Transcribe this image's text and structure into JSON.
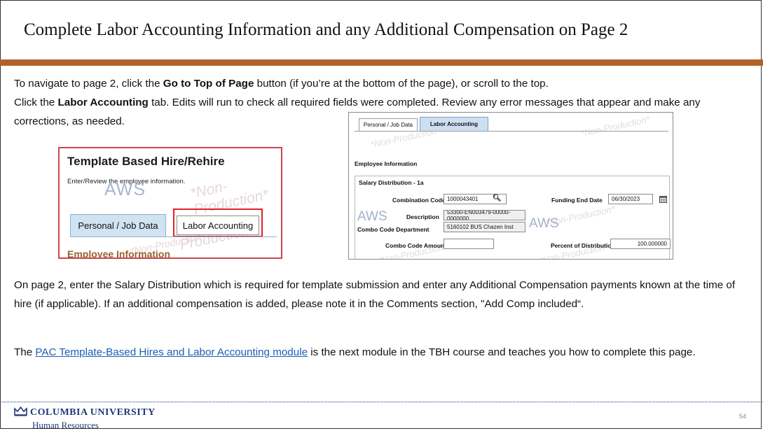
{
  "slide": {
    "title": "Complete Labor Accounting Information and any Additional Compensation on Page 2",
    "accent_color": "#b5602a",
    "page_number": "54"
  },
  "body": {
    "p1_pre": "To navigate to page 2, click the ",
    "p1_bold": "Go to Top of Page",
    "p1_post": " button (if you’re at the bottom of the page), or scroll to the top.",
    "p2_pre": "Click the ",
    "p2_bold": "Labor Accounting",
    "p2_post": " tab. Edits will run to check all required fields were completed. Review any error messages that appear and make any corrections, as needed.",
    "p3": "On page 2, enter the Salary Distribution which is required for template submission and enter any Additional Compensation payments known at the time of hire (if applicable). If an additional compensation is added, please note it in the Comments section, \"Add Comp included“.",
    "p4_pre": "The ",
    "p4_link": "PAC Template-Based Hires and Labor Accounting module",
    "p4_post": " is the next module in the TBH course and teaches you how to complete this page."
  },
  "screenshot1": {
    "title": "Template Based Hire/Rehire",
    "subtitle": "Enter/Review the employee information.",
    "watermark_aws": "AWS",
    "watermark_np": "*Non-Production*",
    "tab_personal": "Personal / Job Data",
    "tab_labor": "Labor Accounting",
    "section_peek": "Employee Information"
  },
  "screenshot2": {
    "tab_personal": "Personal / Job Data",
    "tab_labor": "Labor Accounting",
    "section": "Employee Information",
    "group_title": "Salary Distribution - 1a",
    "combination_code_label": "Combination Code",
    "combination_code_value": "1000043401",
    "funding_end_date_label": "Funding End Date",
    "funding_end_date_value": "06/30/2023",
    "description_label": "Description",
    "description_value": "53300-EN003479-00000-0000000",
    "combo_dept_label": "Combo Code Department",
    "combo_dept_value": "5160102 BUS Chazen Inst",
    "combo_amount_label": "Combo Code Amount",
    "combo_amount_value": "",
    "percent_label": "Percent of Distribution",
    "percent_value": "100.000000",
    "watermark_aws": "AWS",
    "watermark_np": "*Non-Production*"
  },
  "footer": {
    "org": "COLUMBIA UNIVERSITY",
    "dept": "Human Resources"
  }
}
